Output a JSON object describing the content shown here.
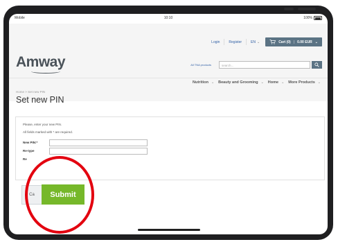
{
  "status_bar": {
    "left": "Mobile",
    "time": "10:10",
    "battery": "100%",
    "battery_level": 1.0
  },
  "header": {
    "login": "Login",
    "register": "Register",
    "language": "EN",
    "cart": {
      "label": "Cart (0)",
      "amount": "0.00 EUR"
    },
    "logo_text": "Amway",
    "tna_link": "All TNA products",
    "search_placeholder": "search...",
    "menu": [
      "Nutrition",
      "Beauty and Grooming",
      "Home",
      "More Products"
    ]
  },
  "breadcrumb": "Home > Set new PIN",
  "page_title": "Set new PIN",
  "form": {
    "instruction": "Please, enter your new PIN.",
    "required_note": "All fields marked with * are required.",
    "fields": [
      {
        "label": "New PIN:*",
        "value": ""
      },
      {
        "label": "Re-type",
        "value": ""
      },
      {
        "label": "Re",
        "value": ""
      }
    ]
  },
  "buttons": {
    "cancel": "Ca",
    "submit": "Submit"
  },
  "colors": {
    "submit_green": "#76b82a",
    "cart_slate": "#5b7384",
    "annotation_red": "#e3000f"
  }
}
